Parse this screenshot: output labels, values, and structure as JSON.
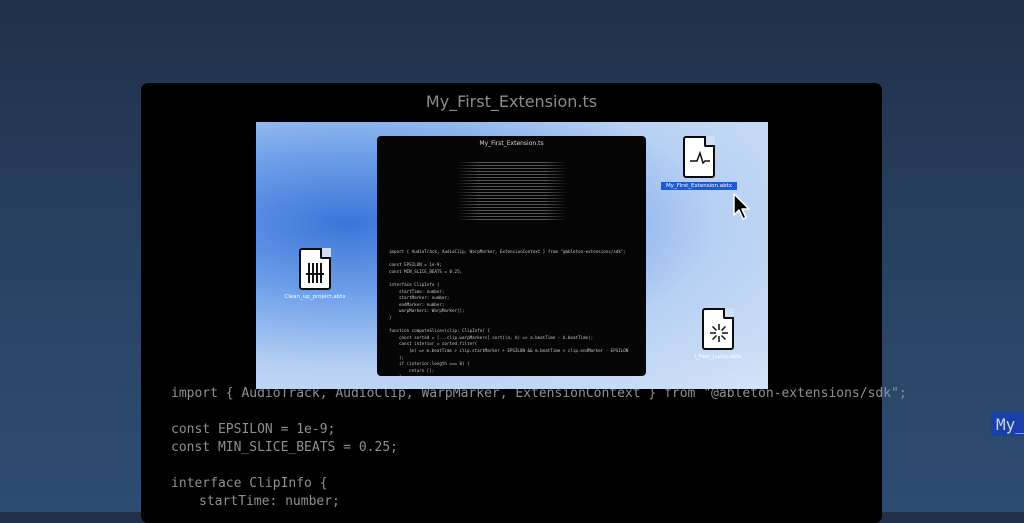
{
  "window": {
    "title": "My_First_Extension.ts"
  },
  "code_lines": [
    "import { AudioTrack, AudioClip, WarpMarker, ExtensionContext } from \"@ableton-extensions/sdk\";",
    "",
    "const EPSILON = 1e-9;",
    "const MIN_SLICE_BEATS = 0.25;",
    "",
    "interface ClipInfo {",
    "startTime: number;"
  ],
  "screenshot": {
    "inner_window": {
      "title": "My_First_Extension.ts",
      "code_lines": [
        "import { AudioTrack, AudioClip, WarpMarker, ExtensionContext } from \"@ableton-extensions/sdk\";",
        "",
        "const EPSILON = 1e-9;",
        "const MIN_SLICE_BEATS = 0.25;",
        "",
        "interface ClipInfo {",
        "startTime: number;",
        "startMarker: number;",
        "endMarker: number;",
        "warpMarkers: WarpMarker[];",
        "}",
        "",
        "function computeSlices(clip: ClipInfo) {",
        "const sorted = [...clip.warpMarkers].sort((a, b) => a.beatTime - b.beatTime);",
        "const interior = sorted.filter(",
        "(m) => m.beatTime > clip.startMarker + EPSILON && m.beatTime < clip.endMarker - EPSILON",
        ");",
        "if (interior.length === 0) {",
        "return [];",
        "}"
      ]
    },
    "desktop_icons": [
      {
        "name": "My_First_Extension.abtx",
        "selected": true,
        "icon": "waveform-icon"
      },
      {
        "name": "Clean_up_project.abtx",
        "selected": false,
        "icon": "barcode-icon"
      },
      {
        "name": "I_Feel_Lucky.abtx",
        "selected": false,
        "icon": "sparkle-icon"
      }
    ]
  },
  "right_tab": {
    "label": "My_"
  },
  "colors": {
    "window_bg": "#000000",
    "selection": "#1d5bd6",
    "page_bg": "#243a59"
  }
}
